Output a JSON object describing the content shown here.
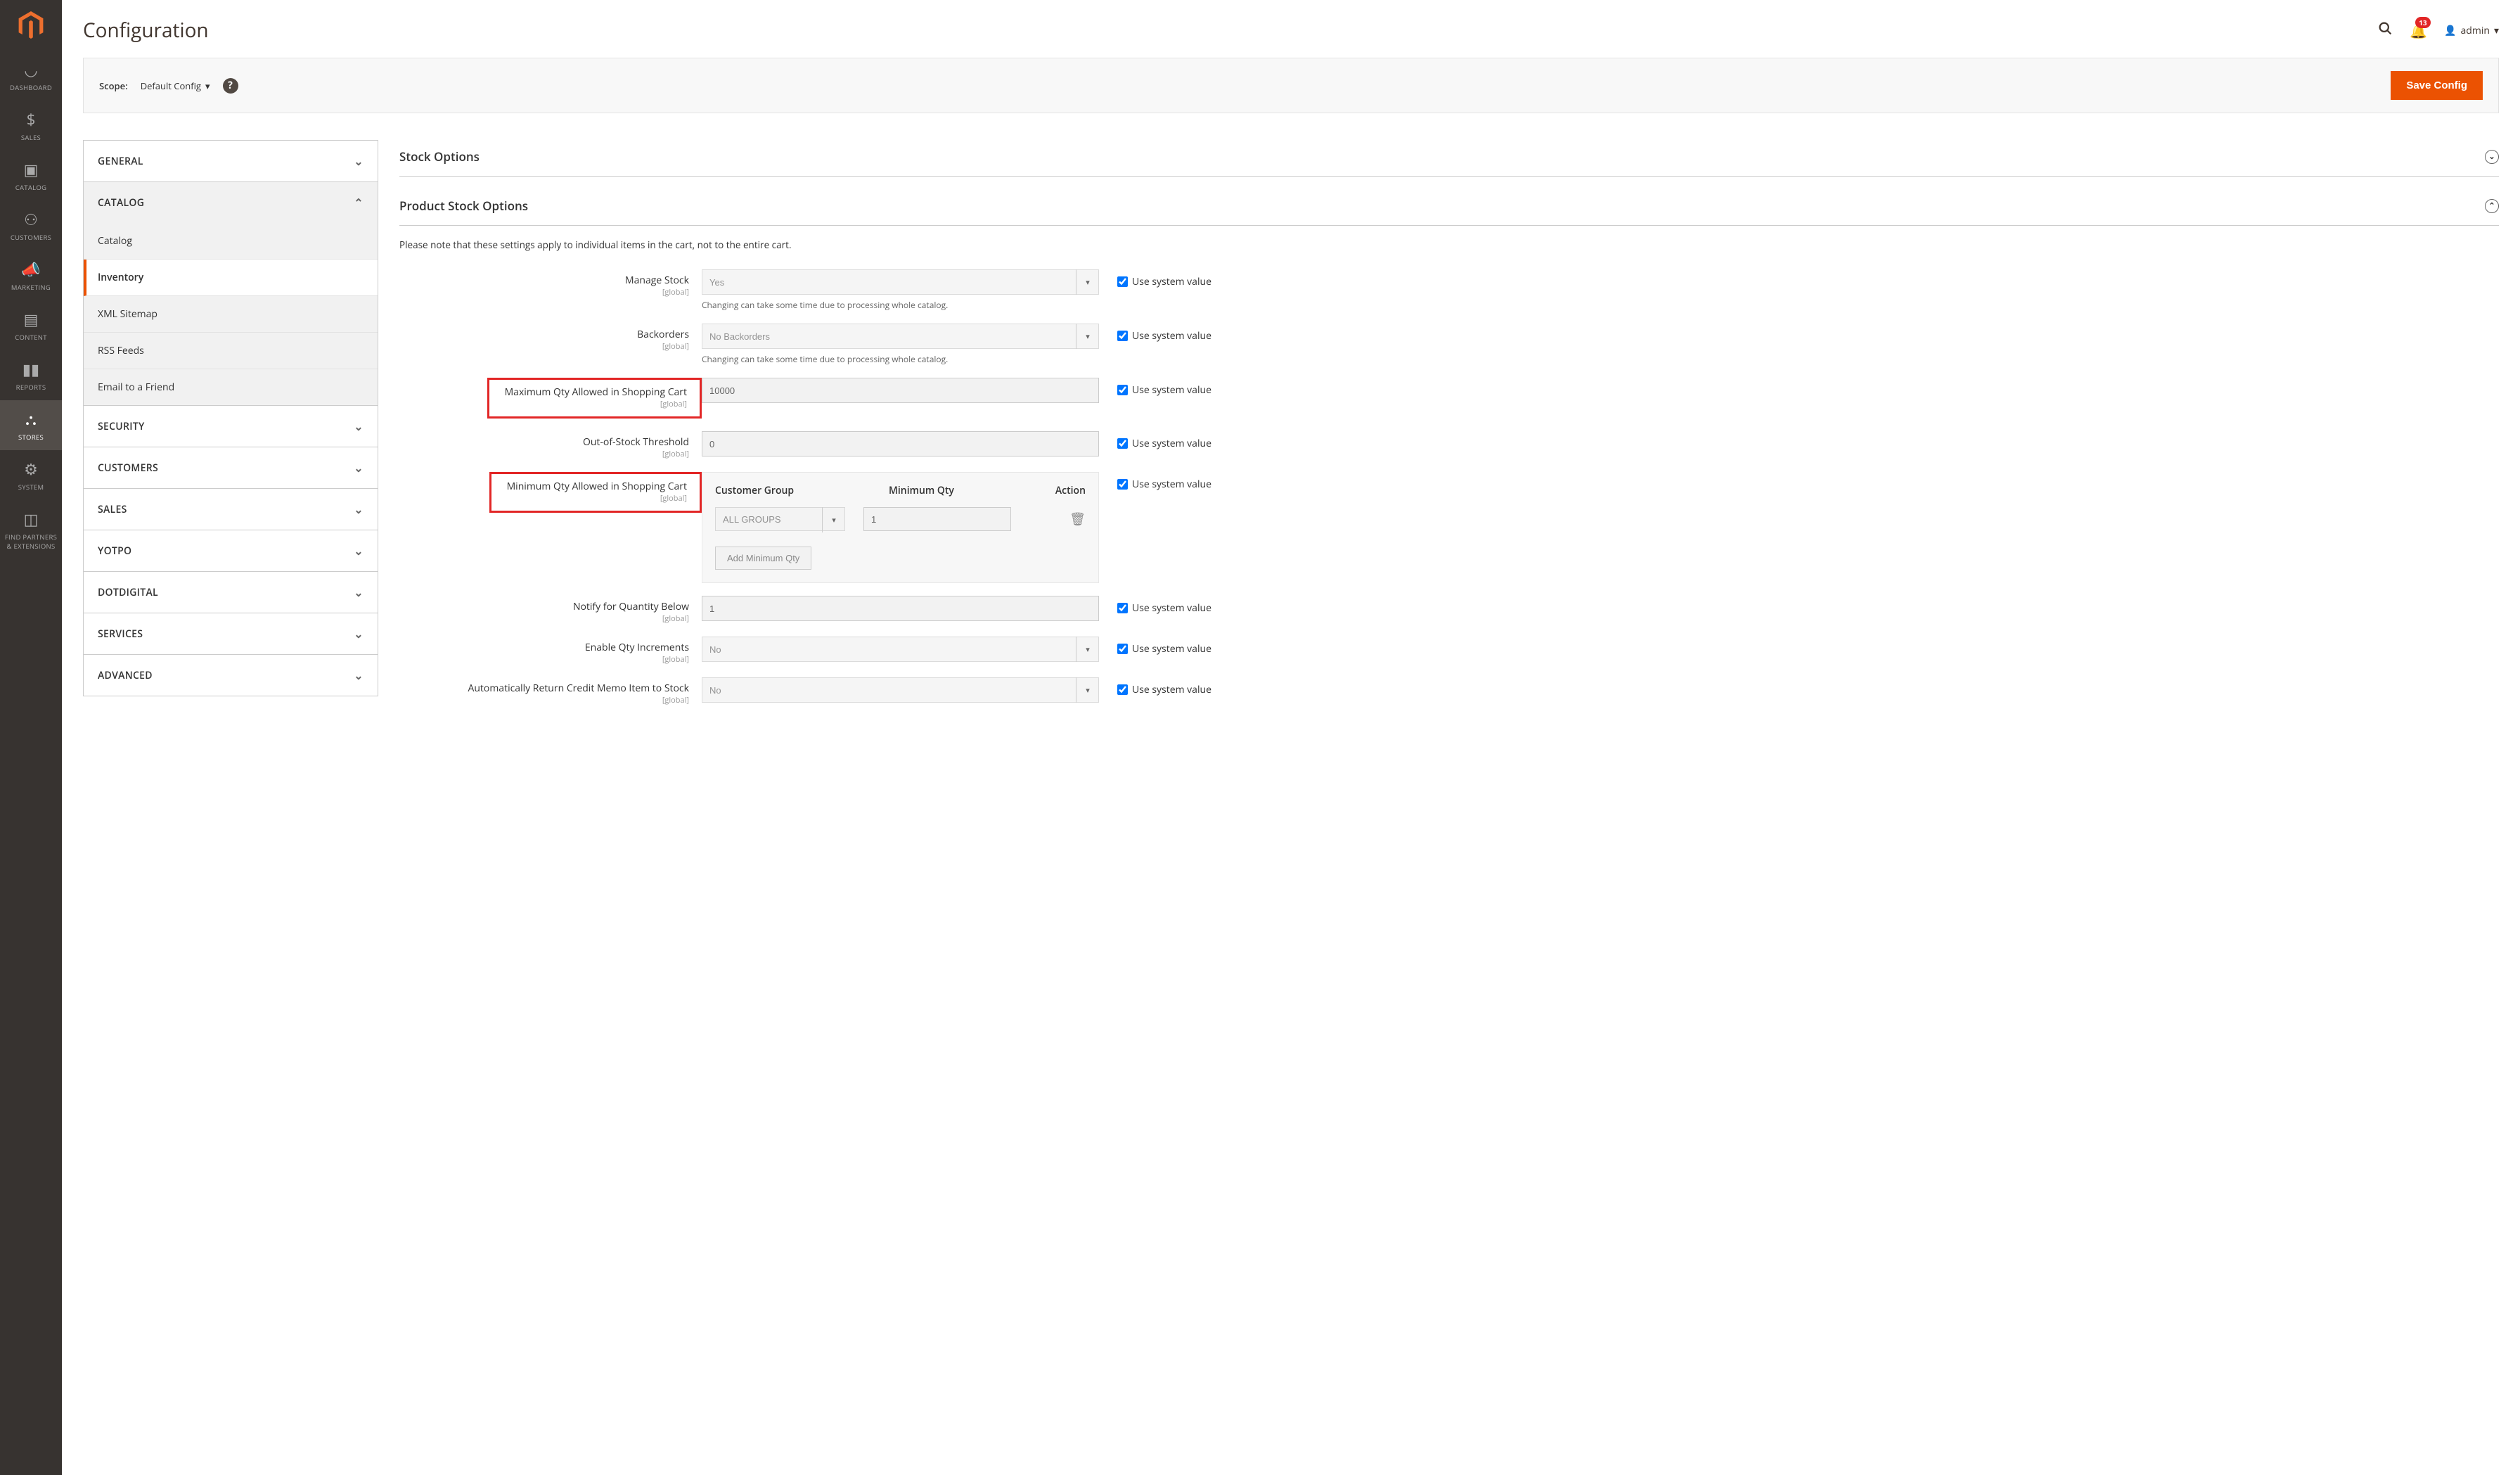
{
  "page_title": "Configuration",
  "notification_count": "13",
  "admin_user": "admin",
  "scope": {
    "label": "Scope:",
    "value": "Default Config"
  },
  "save_button": "Save Config",
  "sidebar": {
    "items": [
      {
        "label": "DASHBOARD"
      },
      {
        "label": "SALES"
      },
      {
        "label": "CATALOG"
      },
      {
        "label": "CUSTOMERS"
      },
      {
        "label": "MARKETING"
      },
      {
        "label": "CONTENT"
      },
      {
        "label": "REPORTS"
      },
      {
        "label": "STORES"
      },
      {
        "label": "SYSTEM"
      },
      {
        "label": "FIND PARTNERS & EXTENSIONS"
      }
    ]
  },
  "nav": {
    "sections": [
      {
        "label": "GENERAL"
      },
      {
        "label": "CATALOG",
        "expanded": true,
        "items": [
          {
            "label": "Catalog"
          },
          {
            "label": "Inventory",
            "active": true
          },
          {
            "label": "XML Sitemap"
          },
          {
            "label": "RSS Feeds"
          },
          {
            "label": "Email to a Friend"
          }
        ]
      },
      {
        "label": "SECURITY"
      },
      {
        "label": "CUSTOMERS"
      },
      {
        "label": "SALES"
      },
      {
        "label": "YOTPO"
      },
      {
        "label": "DOTDIGITAL"
      },
      {
        "label": "SERVICES"
      },
      {
        "label": "ADVANCED"
      }
    ]
  },
  "sections": {
    "stock_options": "Stock Options",
    "product_stock_options": "Product Stock Options"
  },
  "note": "Please note that these settings apply to individual items in the cart, not to the entire cart.",
  "use_system_value": "Use system value",
  "scope_global": "[global]",
  "fields": {
    "manage_stock": {
      "label": "Manage Stock",
      "value": "Yes",
      "help": "Changing can take some time due to processing whole catalog."
    },
    "backorders": {
      "label": "Backorders",
      "value": "No Backorders",
      "help": "Changing can take some time due to processing whole catalog."
    },
    "max_qty": {
      "label": "Maximum Qty Allowed in Shopping Cart",
      "value": "10000"
    },
    "oos_threshold": {
      "label": "Out-of-Stock Threshold",
      "value": "0"
    },
    "min_qty": {
      "label": "Minimum Qty Allowed in Shopping Cart"
    },
    "min_qty_table": {
      "headers": {
        "group": "Customer Group",
        "qty": "Minimum Qty",
        "action": "Action"
      },
      "group_value": "ALL GROUPS",
      "qty_value": "1",
      "add_button": "Add Minimum Qty"
    },
    "notify_below": {
      "label": "Notify for Quantity Below",
      "value": "1"
    },
    "enable_increments": {
      "label": "Enable Qty Increments",
      "value": "No"
    },
    "auto_return": {
      "label": "Automatically Return Credit Memo Item to Stock",
      "value": "No"
    }
  }
}
